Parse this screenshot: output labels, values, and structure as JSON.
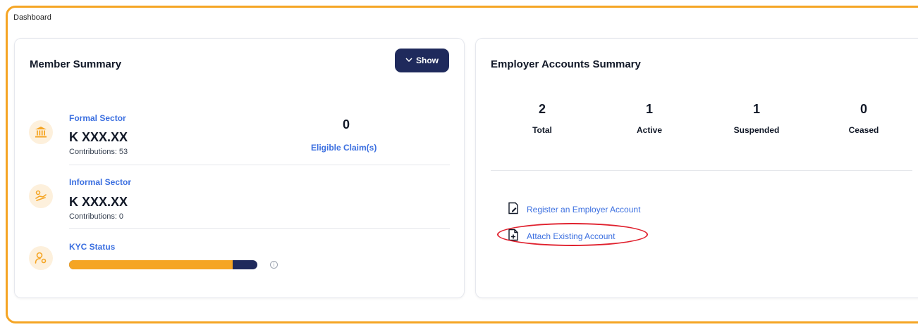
{
  "breadcrumb": "Dashboard",
  "member_summary": {
    "title": "Member Summary",
    "show_button": {
      "icon": "chevron-down-icon",
      "label": "Show"
    },
    "formal": {
      "label": "Formal Sector",
      "amount": "K XXX.XX",
      "contributions": "Contributions: 53",
      "icon": "bank-icon"
    },
    "eligible_claims": {
      "value": "0",
      "label": "Eligible Claim(s)"
    },
    "informal": {
      "label": "Informal Sector",
      "amount": "K XXX.XX",
      "contributions": "Contributions: 0",
      "icon": "hand-coin-icon"
    },
    "kyc": {
      "label": "KYC Status",
      "progress_fraction": 0.87,
      "icon": "user-gear-icon"
    }
  },
  "employer_summary": {
    "title": "Employer Accounts Summary",
    "stats": [
      {
        "value": "2",
        "label": "Total"
      },
      {
        "value": "1",
        "label": "Active"
      },
      {
        "value": "1",
        "label": "Suspended"
      },
      {
        "value": "0",
        "label": "Ceased"
      }
    ],
    "actions": [
      {
        "label": "Register an Employer Account",
        "icon": "edit-document-icon"
      },
      {
        "label": "Attach Existing Account",
        "icon": "add-document-icon"
      }
    ]
  },
  "colors": {
    "accent": "#f5a524",
    "navy": "#1f2a5c",
    "link": "#3b6fe0",
    "highlight": "#e0212e"
  }
}
